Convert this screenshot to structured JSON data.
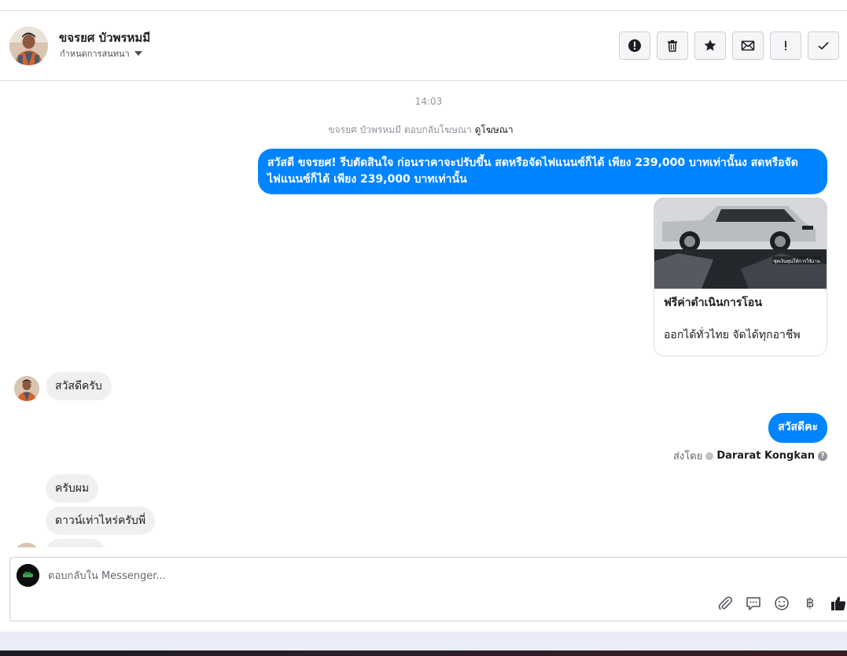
{
  "header": {
    "contact_name": "ขจรยศ บัวพรหมมี",
    "subtitle": "กำหนดการสนทนา",
    "actions": [
      {
        "name": "report-icon",
        "label": "report"
      },
      {
        "name": "trash-icon",
        "label": "delete"
      },
      {
        "name": "star-icon",
        "label": "star"
      },
      {
        "name": "mail-icon",
        "label": "mark unread"
      },
      {
        "name": "exclamation-icon",
        "label": "spam"
      },
      {
        "name": "check-icon",
        "label": "done"
      }
    ]
  },
  "thread": {
    "time": "14:03",
    "ad_reply_prefix": "ขจรยศ บัวพรหมมี ตอบกลับโฆษณา",
    "ad_reply_link": "ดูโฆษณา",
    "outgoing_1": "สวัสดี ขจรยศ! รีบตัดสินใจ ก่อนราคาจะปรับขึ้น สดหรือจัดไฟแนนซ์ก็ได้  เพียง 239,000 บาทเท่านั้นง สดหรือจัดไฟแนนซ์ก็ได้  เพียง 239,000 บาทเท่านั้น",
    "ad_card": {
      "title": "ฟรีค่าดำเนินการโอน",
      "description": "ออกได้ทั่วไทย จัดได้ทุกอาชีพ",
      "image_caption": "ชุดเงินทุนให้การใช้งาน"
    },
    "incoming_1": "สวัสดีครับ",
    "outgoing_2": "สวัสดีคะ",
    "sent_by_prefix": "ส่งโดย",
    "sent_by_name": "Dararat Kongkan",
    "incoming_2": "ครับผม",
    "incoming_3": "ดาวน์เท่าไหร่ครับพี่"
  },
  "composer": {
    "placeholder": "ตอบกลับใน Messenger...",
    "tools": [
      "paperclip-icon",
      "saved-reply-icon",
      "emoji-icon",
      "baht-icon",
      "thumbs-up-icon"
    ],
    "baht_symbol": "฿"
  },
  "colors": {
    "outgoing_bubble": "#0084ff",
    "incoming_bubble": "#f1f0f0",
    "border": "#dadde1"
  }
}
